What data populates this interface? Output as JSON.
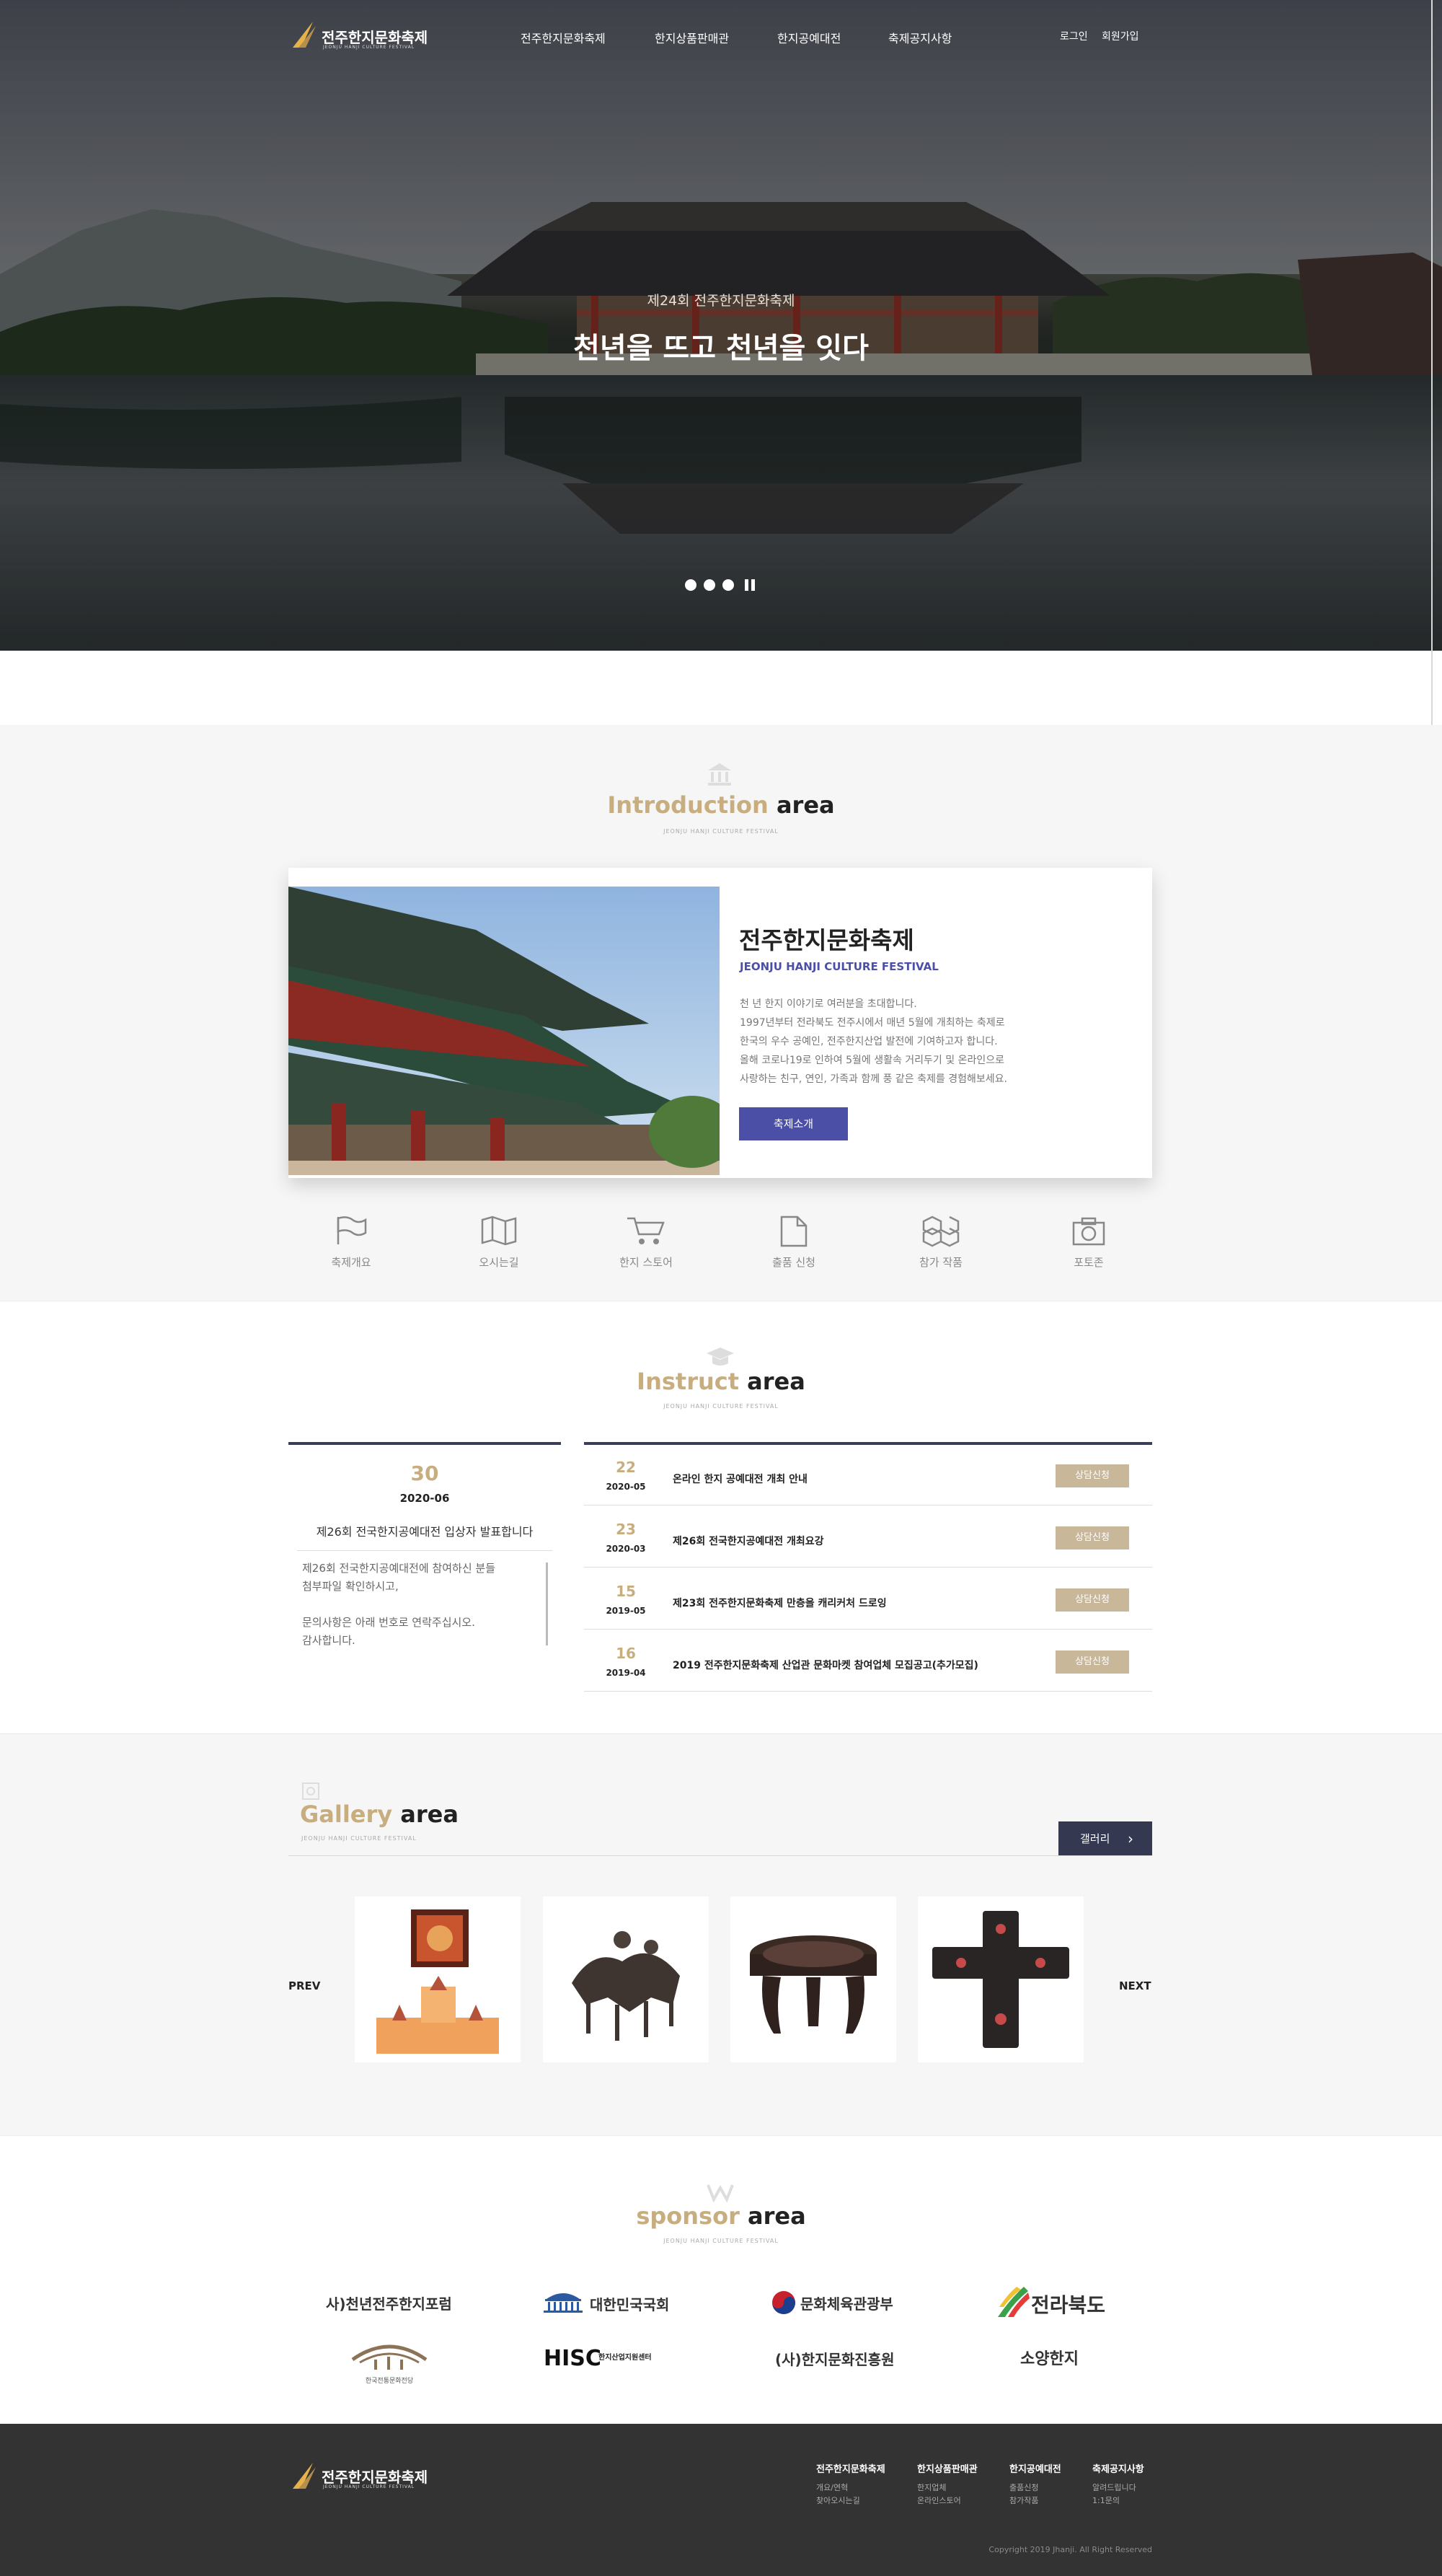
{
  "header": {
    "logo_name": "전주한지문화축제",
    "logo_sub": "JEONJU HANJI CULTURE FESTIVAL",
    "nav": [
      "전주한지문화축제",
      "한지상품판매관",
      "한지공예대전",
      "축제공지사항"
    ],
    "util": [
      "로그인",
      "회원가입"
    ]
  },
  "hero": {
    "subtitle": "제24회 전주한지문화축제",
    "title": "천년을 뜨고 천년을 잇다"
  },
  "intro": {
    "title_gold": "Introduction",
    "title_dark": "area",
    "sub": "JEONJU HANJI CULTURE FESTIVAL",
    "card": {
      "heading": "전주한지문화축제",
      "eng": "JEONJU HANJI CULTURE FESTIVAL",
      "lines": [
        "천 년 한지 이야기로 여러분을 초대합니다.",
        "1997년부터 전라북도 전주시에서 매년 5월에 개최하는 축제로",
        "한국의 우수 공예인, 전주한지산업 발전에 기여하고자 합니다.",
        "올해 코로나19로 인하여 5월에 생활속 거리두기 및 온라인으로",
        "사랑하는 친구, 연인, 가족과 함께 풍 같은 축제를 경험해보세요."
      ],
      "button": "축제소개"
    },
    "quick": [
      "축제개요",
      "오시는길",
      "한지 스토어",
      "출품 신청",
      "참가 작품",
      "포토존"
    ]
  },
  "instruct": {
    "title_gold": "Instruct",
    "title_dark": "area",
    "sub": "JEONJU HANJI CULTURE FESTIVAL",
    "featured": {
      "day": "30",
      "ym": "2020-06",
      "headline": "제26회 전국한지공예대전 입상자 발표합니다",
      "body": [
        "제26회 전국한지공예대전에 참여하신 분들",
        "첨부파일 확인하시고,",
        "",
        "문의사항은 아래 번호로 연락주십시오.",
        "감사합니다."
      ]
    },
    "rows": [
      {
        "day": "22",
        "ym": "2020-05",
        "title": "온라인 한지 공예대전 개최 안내",
        "badge": "상담신청"
      },
      {
        "day": "23",
        "ym": "2020-03",
        "title": "제26회 전국한지공예대전 개최요강",
        "badge": "상담신청"
      },
      {
        "day": "15",
        "ym": "2019-05",
        "title": "제23회 전주한지문화축제 만층을 캐리커처 드로잉",
        "badge": "상담신청"
      },
      {
        "day": "16",
        "ym": "2019-04",
        "title": "2019 전주한지문화축제 산업관 문화마켓 참여업체 모집공고(추가모집)",
        "badge": "상담신청"
      }
    ]
  },
  "gallery": {
    "title_gold": "Gallery",
    "title_dark": "area",
    "sub": "JEONJU HANJI CULTURE FESTIVAL",
    "more": "갤러리",
    "prev": "PREV",
    "next": "NEXT"
  },
  "sponsor": {
    "title_gold": "sponsor",
    "title_dark": "area",
    "sub": "JEONJU HANJI CULTURE FESTIVAL",
    "items": [
      "사)천년전주한지포럼",
      "대한민국국회",
      "문화체육관광부",
      "전라북도",
      "한국전통문화전당",
      "HISC",
      "한지산업지원센터",
      "(사)한지문화진흥원",
      "소양한지"
    ]
  },
  "footer": {
    "logo_name": "전주한지문화축제",
    "logo_sub": "JEONJU HANJI CULTURE FESTIVAL",
    "cols": [
      {
        "head": "전주한지문화축제",
        "l1": "개요/연혁",
        "l2": "찾아오시는길"
      },
      {
        "head": "한지상품판매관",
        "l1": "한지업체",
        "l2": "온라인스토어"
      },
      {
        "head": "한지공예대전",
        "l1": "출품신청",
        "l2": "참가작품"
      },
      {
        "head": "축제공지사항",
        "l1": "알려드립니다",
        "l2": "1:1문의"
      }
    ],
    "copyright": "Copyright 2019 Jhanji. All Right Reserved"
  },
  "colors": {
    "gold": "#c8ad7f",
    "purple": "#4b4fa5",
    "footer_bg": "#333333"
  }
}
